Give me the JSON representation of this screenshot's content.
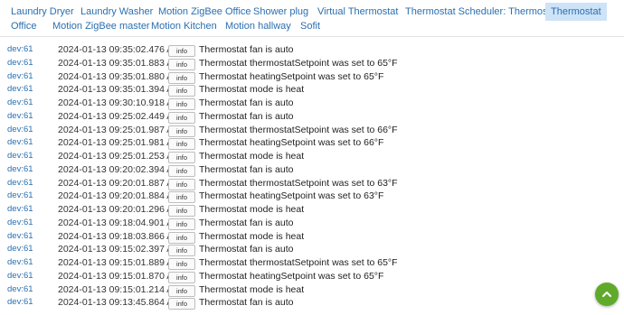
{
  "tabs": [
    {
      "label": "Laundry Dryer",
      "active": false
    },
    {
      "label": "Laundry Washer",
      "active": false
    },
    {
      "label": "Motion ZigBee Office",
      "active": false
    },
    {
      "label": "Shower plug",
      "active": false
    },
    {
      "label": "Virtual Thermostat",
      "active": false
    },
    {
      "label": "Thermostat Scheduler: Thermostat",
      "active": false
    },
    {
      "label": "Thermostat",
      "active": true
    },
    {
      "label": "Office",
      "active": false
    },
    {
      "label": "Motion ZigBee master",
      "active": false
    },
    {
      "label": "Motion Kitchen",
      "active": false
    },
    {
      "label": "Motion hallway",
      "active": false
    },
    {
      "label": "Sofit",
      "active": false
    }
  ],
  "logs": [
    {
      "device": "dev:61",
      "time": "2024-01-13 09:35:02.476 AM",
      "level": "info",
      "message": "Thermostat fan is auto"
    },
    {
      "device": "dev:61",
      "time": "2024-01-13 09:35:01.883 AM",
      "level": "info",
      "message": "Thermostat thermostatSetpoint was set to 65°F"
    },
    {
      "device": "dev:61",
      "time": "2024-01-13 09:35:01.880 AM",
      "level": "info",
      "message": "Thermostat heatingSetpoint was set to 65°F"
    },
    {
      "device": "dev:61",
      "time": "2024-01-13 09:35:01.394 AM",
      "level": "info",
      "message": "Thermostat mode is heat"
    },
    {
      "device": "dev:61",
      "time": "2024-01-13 09:30:10.918 AM",
      "level": "info",
      "message": "Thermostat fan is auto"
    },
    {
      "device": "dev:61",
      "time": "2024-01-13 09:25:02.449 AM",
      "level": "info",
      "message": "Thermostat fan is auto"
    },
    {
      "device": "dev:61",
      "time": "2024-01-13 09:25:01.987 AM",
      "level": "info",
      "message": "Thermostat thermostatSetpoint was set to 66°F"
    },
    {
      "device": "dev:61",
      "time": "2024-01-13 09:25:01.981 AM",
      "level": "info",
      "message": "Thermostat heatingSetpoint was set to 66°F"
    },
    {
      "device": "dev:61",
      "time": "2024-01-13 09:25:01.253 AM",
      "level": "info",
      "message": "Thermostat mode is heat"
    },
    {
      "device": "dev:61",
      "time": "2024-01-13 09:20:02.394 AM",
      "level": "info",
      "message": "Thermostat fan is auto"
    },
    {
      "device": "dev:61",
      "time": "2024-01-13 09:20:01.887 AM",
      "level": "info",
      "message": "Thermostat thermostatSetpoint was set to 63°F"
    },
    {
      "device": "dev:61",
      "time": "2024-01-13 09:20:01.884 AM",
      "level": "info",
      "message": "Thermostat heatingSetpoint was set to 63°F"
    },
    {
      "device": "dev:61",
      "time": "2024-01-13 09:20:01.296 AM",
      "level": "info",
      "message": "Thermostat mode is heat"
    },
    {
      "device": "dev:61",
      "time": "2024-01-13 09:18:04.901 AM",
      "level": "info",
      "message": "Thermostat fan is auto"
    },
    {
      "device": "dev:61",
      "time": "2024-01-13 09:18:03.866 AM",
      "level": "info",
      "message": "Thermostat mode is heat"
    },
    {
      "device": "dev:61",
      "time": "2024-01-13 09:15:02.397 AM",
      "level": "info",
      "message": "Thermostat fan is auto"
    },
    {
      "device": "dev:61",
      "time": "2024-01-13 09:15:01.889 AM",
      "level": "info",
      "message": "Thermostat thermostatSetpoint was set to 65°F"
    },
    {
      "device": "dev:61",
      "time": "2024-01-13 09:15:01.870 AM",
      "level": "info",
      "message": "Thermostat heatingSetpoint was set to 65°F"
    },
    {
      "device": "dev:61",
      "time": "2024-01-13 09:15:01.214 AM",
      "level": "info",
      "message": "Thermostat mode is heat"
    },
    {
      "device": "dev:61",
      "time": "2024-01-13 09:13:45.864 AM",
      "level": "info",
      "message": "Thermostat fan is auto"
    }
  ],
  "fab": {
    "icon": "chevron-up-icon",
    "color": "#5faa2a"
  }
}
